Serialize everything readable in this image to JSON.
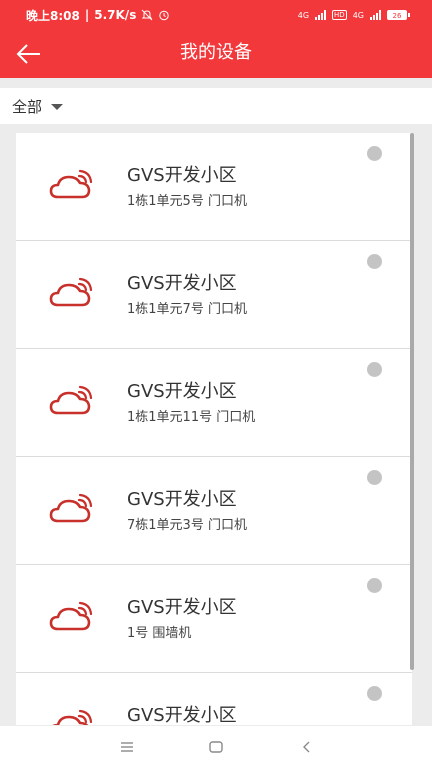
{
  "status_bar": {
    "time_text": "晚上8:08",
    "speed_text": "5.7K/s",
    "network_labels": [
      "4G",
      "4G"
    ],
    "hd_label": "HD",
    "battery_text": "26"
  },
  "app_bar": {
    "title": "我的设备",
    "back_icon": "arrow-left-icon"
  },
  "filter": {
    "label": "全部",
    "icon": "caret-down-icon"
  },
  "devices": [
    {
      "name": "GVS开发小区",
      "desc": "1栋1单元5号 门口机"
    },
    {
      "name": "GVS开发小区",
      "desc": "1栋1单元7号 门口机"
    },
    {
      "name": "GVS开发小区",
      "desc": "1栋1单元11号 门口机"
    },
    {
      "name": "GVS开发小区",
      "desc": "7栋1单元3号 门口机"
    },
    {
      "name": "GVS开发小区",
      "desc": "1号 围墙机"
    },
    {
      "name": "GVS开发小区",
      "desc": ""
    }
  ],
  "colors": {
    "brand_red": "#f2383b",
    "icon_red": "#c8312b",
    "status_dot": "#c4c4c4"
  },
  "nav_bar": {
    "icons": [
      "menu-icon",
      "home-icon",
      "back-icon"
    ]
  }
}
